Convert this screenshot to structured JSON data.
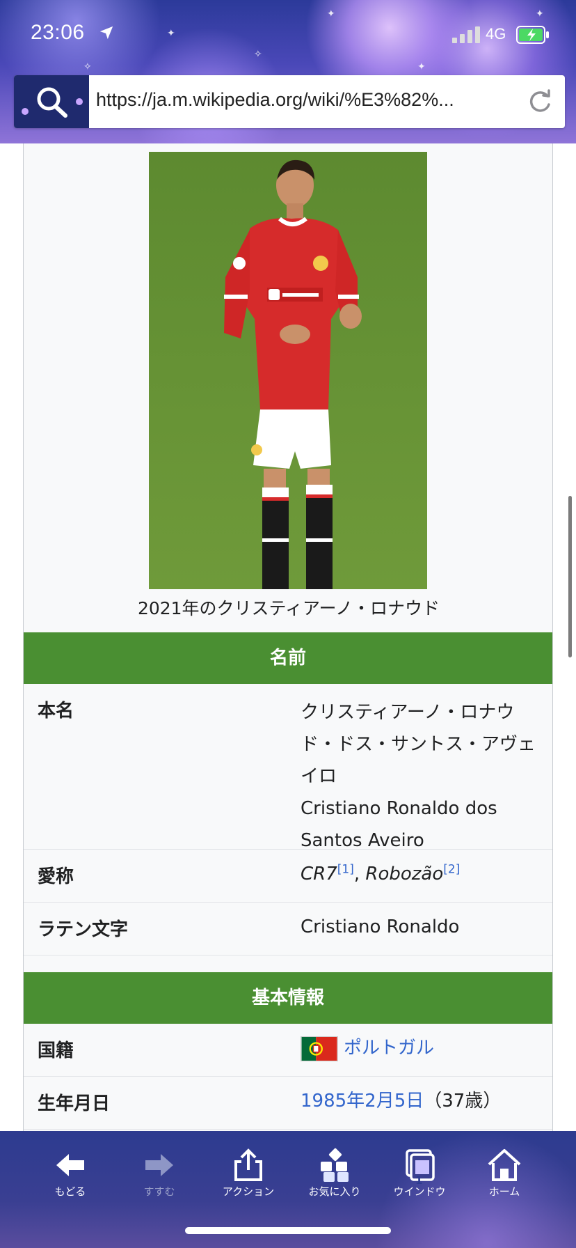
{
  "status_bar": {
    "time": "23:06",
    "network": "4G"
  },
  "browser": {
    "url": "https://ja.m.wikipedia.org/wiki/%E3%82%..."
  },
  "infobox": {
    "caption": "2021年のクリスティアーノ・ロナウド",
    "sections": [
      {
        "header": "名前"
      },
      {
        "header": "基本情報"
      }
    ],
    "real_name": {
      "label": "本名",
      "value_ja": "クリスティアーノ・ロナウド・ドス・サントス・アヴェイロ",
      "value_en": "Cristiano Ronaldo dos Santos Aveiro"
    },
    "nickname": {
      "label": "愛称",
      "name1": "CR7",
      "ref1": "[1]",
      "separator": ", ",
      "name2": "Robozão",
      "ref2": "[2]"
    },
    "latin": {
      "label": "ラテン文字",
      "value": "Cristiano Ronaldo"
    },
    "nationality": {
      "label": "国籍",
      "value": "ポルトガル"
    },
    "birth": {
      "label": "生年月日",
      "date": "1985年2月5日",
      "age": "（37歳）"
    }
  },
  "toolbar": {
    "items": [
      {
        "label": "もどる",
        "icon": "back-arrow-icon"
      },
      {
        "label": "すすむ",
        "icon": "forward-arrow-icon"
      },
      {
        "label": "アクション",
        "icon": "share-icon"
      },
      {
        "label": "お気に入り",
        "icon": "favorites-icon"
      },
      {
        "label": "ウインドウ",
        "icon": "windows-icon",
        "count": "1"
      },
      {
        "label": "ホーム",
        "icon": "home-icon"
      }
    ]
  },
  "colors": {
    "section_header": "#4a8f32",
    "link": "#3366cc",
    "infobox_bg": "#f8f9fa"
  }
}
